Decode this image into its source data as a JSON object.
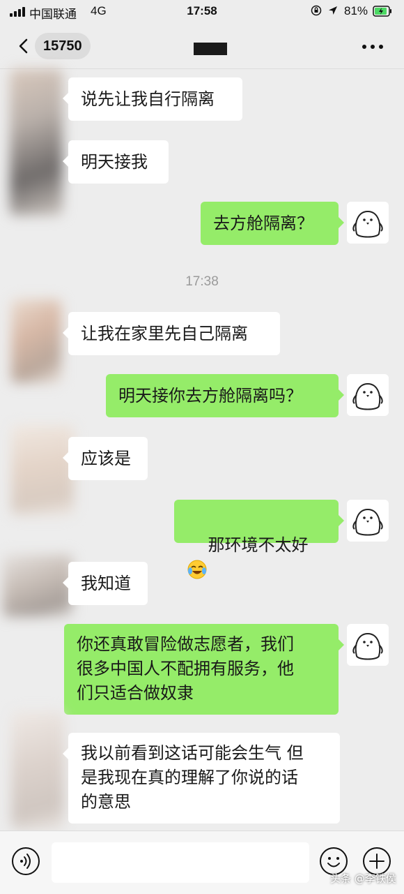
{
  "status_bar": {
    "carrier": "中国联通",
    "network": "4G",
    "time": "17:58",
    "battery_percent": "81%",
    "icons": [
      "signal-icon",
      "rotation-lock-icon",
      "location-icon",
      "battery-charging-icon"
    ]
  },
  "nav": {
    "back_icon": "chevron-left-icon",
    "unread_count": "15750",
    "title_redacted": true,
    "more_icon": "more-dots-icon"
  },
  "messages": [
    {
      "from": "them",
      "text": "说先让我自行隔离"
    },
    {
      "from": "them",
      "text": "明天接我"
    },
    {
      "from": "me",
      "text": "去方舱隔离？"
    },
    {
      "type": "time",
      "text": "17:38"
    },
    {
      "from": "them",
      "text": "让我在家里先自己隔离"
    },
    {
      "from": "me",
      "text": "明天接你去方舱隔离吗？"
    },
    {
      "from": "them",
      "text": "应该是"
    },
    {
      "from": "me",
      "text": "那环境不太好",
      "emoji": "crying-laughing-emoji"
    },
    {
      "from": "them",
      "text": "我知道"
    },
    {
      "from": "me",
      "text": "你还真敢冒险做志愿者，我们\n很多中国人不配拥有服务，他\n们只适合做奴隶"
    },
    {
      "from": "them",
      "text": "我以前看到这话可能会生气 但\n是我现在真的理解了你说的话\n的意思"
    }
  ],
  "input_bar": {
    "voice_icon": "voice-icon",
    "input_value": "",
    "emoji_icon": "emoji-face-icon",
    "plus_icon": "plus-circle-icon"
  },
  "watermark": "头条 @李铁侯",
  "colors": {
    "background": "#ededed",
    "outgoing_bubble": "#95ec69",
    "incoming_bubble": "#ffffff"
  }
}
